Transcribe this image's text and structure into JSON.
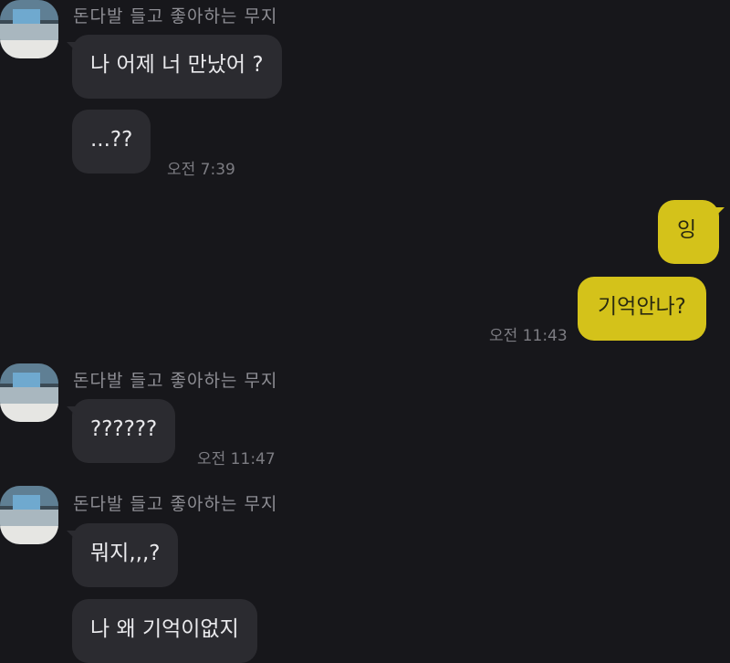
{
  "conversation": {
    "sender_name": "돈다발 들고 좋아하는 무지",
    "messages": [
      {
        "text": "나 어제 너 만났어 ?"
      },
      {
        "text": "...??",
        "time": "오전 7:39"
      },
      {
        "text": "잉"
      },
      {
        "text": "기억안나?",
        "time": "오전 11:43"
      },
      {
        "text": "??????",
        "time": "오전 11:47"
      },
      {
        "text": "뭐지,,,?"
      },
      {
        "text": "나 왜 기억이없지"
      }
    ]
  },
  "colors": {
    "background": "#17171b",
    "incoming_bubble": "#2b2b30",
    "outgoing_bubble": "#d4c21a",
    "timestamp": "#7c7c82",
    "sender_name": "#8e8e94"
  }
}
